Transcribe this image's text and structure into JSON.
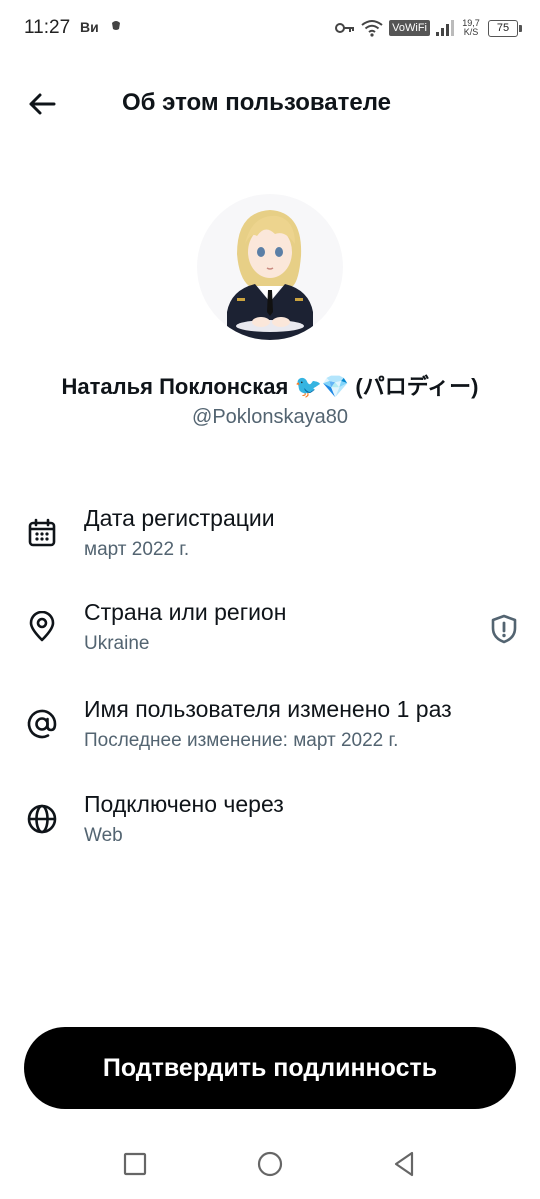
{
  "status_bar": {
    "time": "11:27",
    "carrier": "Ви",
    "vowifi": "VoWiFi",
    "speed_value": "19,7",
    "speed_unit": "K/S",
    "battery": "75"
  },
  "header": {
    "back_icon": "arrow-left-icon",
    "title": "Об этом пользователе"
  },
  "profile": {
    "display_name": "Наталья Поклонская 🐦💎 (パロディー)",
    "handle": "@Poklonskaya80"
  },
  "info": [
    {
      "icon": "calendar-icon",
      "title": "Дата регистрации",
      "subtitle": "март 2022 г."
    },
    {
      "icon": "location-pin-icon",
      "title": "Страна или регион",
      "subtitle": "Ukraine"
    },
    {
      "icon": "at-sign-icon",
      "title": "Имя пользователя изменено 1 раз",
      "subtitle": "Последнее изменение: март 2022 г."
    },
    {
      "icon": "globe-icon",
      "title": "Подключено через",
      "subtitle": "Web"
    }
  ],
  "verify_button": {
    "label": "Подтвердить подлинность"
  },
  "colors": {
    "text": "#0f1419",
    "secondary": "#536471",
    "button": "#000000",
    "bird": "#1d9bf0"
  }
}
